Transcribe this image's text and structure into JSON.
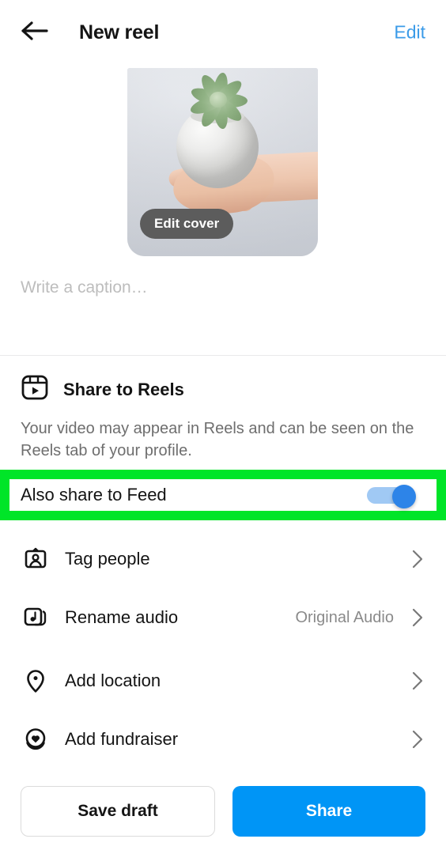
{
  "header": {
    "back_icon": "arrow-left-icon",
    "title": "New reel",
    "edit_label": "Edit",
    "edit_color": "#3B9BE8"
  },
  "thumbnail": {
    "edit_cover_label": "Edit cover",
    "description": "hand holding white ceramic pot with succulent on light grey background"
  },
  "caption": {
    "placeholder": "Write a caption…",
    "value": ""
  },
  "reels": {
    "icon": "reels-clapperboard-icon",
    "title": "Share to Reels",
    "description": "Your video may appear in Reels and can be seen on the Reels tab of your profile."
  },
  "feed_toggle": {
    "label": "Also share to Feed",
    "state": "on",
    "track_color": "#a0c9f4",
    "knob_color": "#2d84e8",
    "highlight_color": "#00E528"
  },
  "options": [
    {
      "icon": "tag-people-icon",
      "label": "Tag people",
      "value": "",
      "chevron": "chevron-right-icon"
    },
    {
      "icon": "music-note-icon",
      "label": "Rename audio",
      "value": "Original Audio",
      "chevron": "chevron-right-icon"
    },
    {
      "icon": "location-pin-icon",
      "label": "Add location",
      "value": "",
      "chevron": "chevron-right-icon"
    },
    {
      "icon": "fundraiser-heart-icon",
      "label": "Add fundraiser",
      "value": "",
      "chevron": "chevron-right-icon"
    }
  ],
  "actions": {
    "save_draft_label": "Save draft",
    "share_label": "Share",
    "share_color": "#0095F6"
  }
}
